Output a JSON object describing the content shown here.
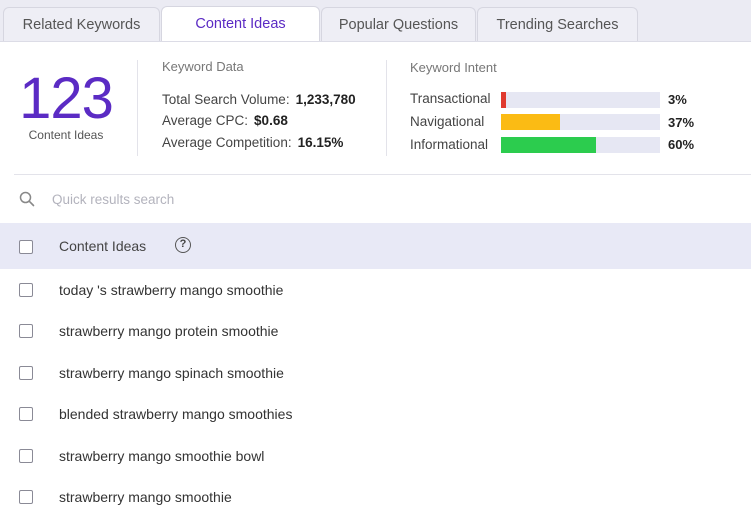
{
  "tabs": [
    {
      "label": "Related Keywords"
    },
    {
      "label": "Content Ideas"
    },
    {
      "label": "Popular Questions"
    },
    {
      "label": "Trending Searches"
    }
  ],
  "active_tab": "Content Ideas",
  "summary": {
    "count": "123",
    "count_label": "Content Ideas"
  },
  "keyword_data": {
    "title": "Keyword Data",
    "total_search_volume_label": "Total Search Volume:",
    "total_search_volume": "1,233,780",
    "avg_cpc_label": "Average CPC:",
    "avg_cpc": "$0.68",
    "avg_competition_label": "Average Competition:",
    "avg_competition": "16.15%"
  },
  "keyword_intent": {
    "title": "Keyword Intent",
    "items": [
      {
        "label": "Transactional",
        "pct_text": "3%",
        "value": 3,
        "color": "#e03a2f"
      },
      {
        "label": "Navigational",
        "pct_text": "37%",
        "value": 37,
        "color": "#fbbb14"
      },
      {
        "label": "Informational",
        "pct_text": "60%",
        "value": 60,
        "color": "#2ccc4e"
      }
    ]
  },
  "search": {
    "placeholder": "Quick results search",
    "value": ""
  },
  "table": {
    "header": "Content Ideas",
    "help": "?",
    "rows": [
      "today 's strawberry mango smoothie",
      "strawberry mango protein smoothie",
      "strawberry mango spinach smoothie",
      "blended strawberry mango smoothies",
      "strawberry mango smoothie bowl",
      "strawberry mango smoothie"
    ]
  },
  "colors": {
    "accent": "#5b2bc4",
    "tab_bar_bg": "#ebebf3",
    "table_header_bg": "#e8e9f6",
    "intent_track": "#e6e7f3"
  }
}
